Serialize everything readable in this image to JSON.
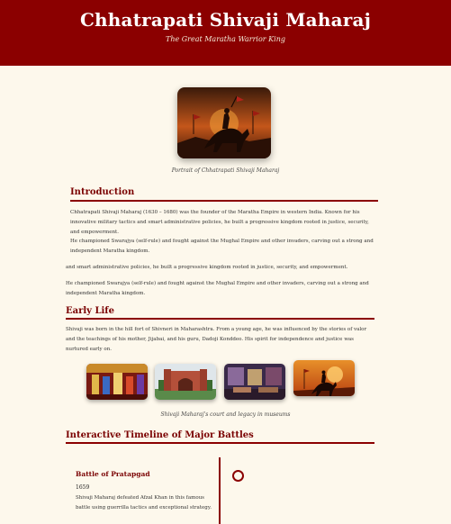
{
  "header": {
    "title": "Chhatrapati Shivaji Maharaj",
    "subtitle": "The Great Maratha Warrior King"
  },
  "portrait": {
    "caption": "Portrait of Chhatrapati Shivaji Maharaj"
  },
  "introduction": {
    "title": "Introduction",
    "p1": "Chhatrapati Shivaji Maharaj (1630 – 1680) was the founder of the Maratha Empire in western India. Known for his innovative military tactics and smart administrative policies, he built a progressive kingdom rooted in justice, security, and empowerment.",
    "p2": "He championed Swarajya (self-rule) and fought against the Mughal Empire and other invaders, carving out a strong and independent Maratha kingdom.",
    "dup1": "and smart administrative policies, he built a progressive kingdom rooted in justice, security, and empowerment.",
    "dup2": "He championed Swarajya (self-rule) and fought against the Mughal Empire and other invaders, carving out a strong and independent Maratha kingdom."
  },
  "early_life": {
    "title": "Early Life",
    "p1": "Shivaji was born in the hill fort of Shivneri in Maharashtra. From a young age, he was influenced by the stories of valor and the teachings of his mother, Jijabai, and his guru, Dadoji Konddeo. His spirit for independence and justice was nurtured early on."
  },
  "gallery": {
    "caption": "Shivaji Maharaj's court and legacy in museums"
  },
  "timeline": {
    "title": "Interactive Timeline of Major Battles",
    "items": [
      {
        "title": "Battle of Pratapgad",
        "year": "1659",
        "desc": "Shivaji Maharaj defeated Afzal Khan in this famous battle using guerrilla tactics and exceptional strategy."
      }
    ]
  },
  "colors": {
    "accent": "#8b0000",
    "background": "#fdf8ec"
  }
}
